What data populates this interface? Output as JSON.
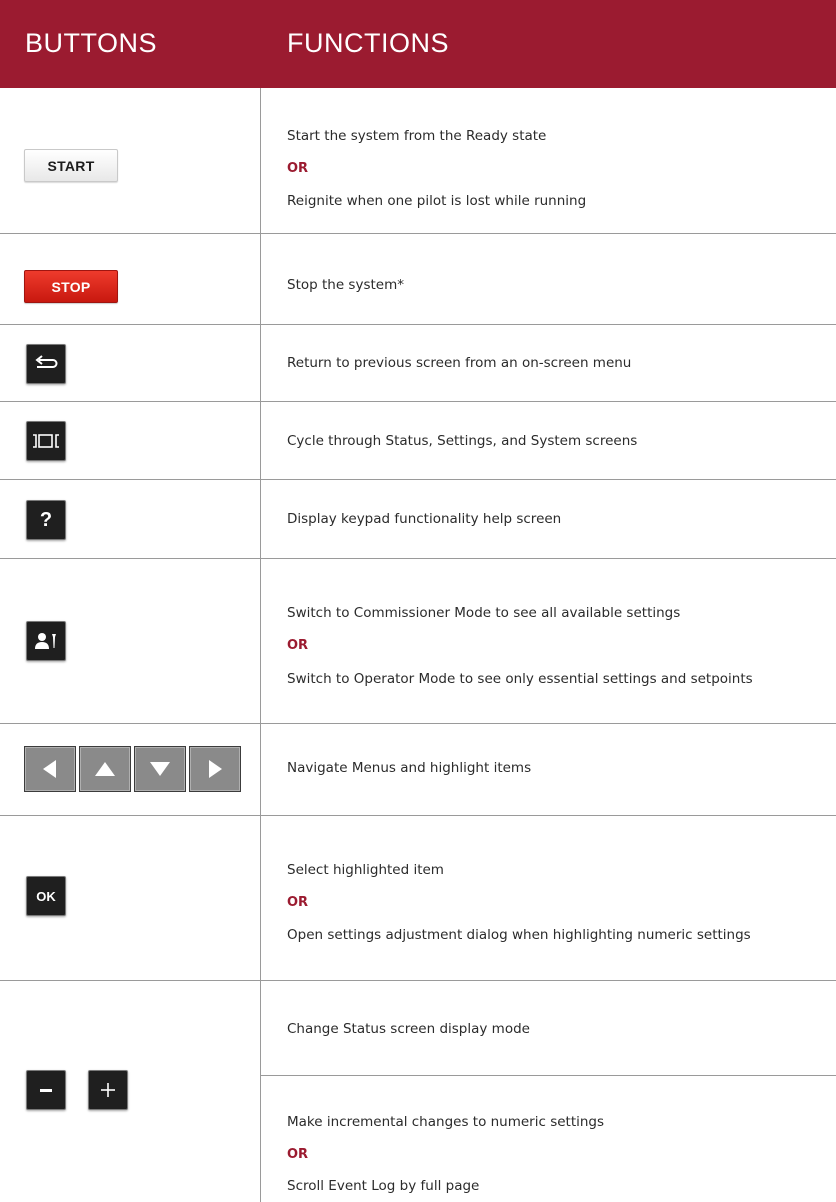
{
  "header": {
    "col_buttons": "BUTTONS",
    "col_functions": "FUNCTIONS"
  },
  "colors": {
    "header_bg": "#9b1b30",
    "or_text": "#9b1b30",
    "stop_button": "#d92419"
  },
  "rows": [
    {
      "button": {
        "label": "START",
        "icon": "start-button"
      },
      "lines": [
        "Start the system from the Ready state",
        "OR",
        "Reignite when one pilot is lost while running"
      ]
    },
    {
      "button": {
        "label": "STOP",
        "icon": "stop-button"
      },
      "lines": [
        "Stop the system*"
      ]
    },
    {
      "button": {
        "icon": "back-arrow-icon"
      },
      "lines": [
        "Return to previous screen from an on-screen menu"
      ]
    },
    {
      "button": {
        "icon": "cycle-screens-icon"
      },
      "lines": [
        "Cycle through Status, Settings, and System screens"
      ]
    },
    {
      "button": {
        "label": "?",
        "icon": "help-icon"
      },
      "lines": [
        "Display keypad functionality help screen"
      ]
    },
    {
      "button": {
        "icon": "user-mode-icon"
      },
      "lines": [
        "Switch to Commissioner Mode to see all available settings",
        "OR",
        "Switch to Operator Mode to see only essential settings and setpoints"
      ]
    },
    {
      "button": {
        "icon": "arrow-keys-icons"
      },
      "lines": [
        "Navigate Menus and highlight items"
      ]
    },
    {
      "button": {
        "label": "OK",
        "icon": "ok-button"
      },
      "lines": [
        "Select highlighted item",
        "OR",
        "Open settings adjustment dialog when highlighting numeric settings"
      ]
    },
    {
      "button": {
        "icon": "minus-plus-icons"
      },
      "lines": [
        "Change Status screen display mode",
        "Make incremental changes to numeric settings",
        "OR",
        "Scroll Event Log by full page"
      ]
    }
  ]
}
